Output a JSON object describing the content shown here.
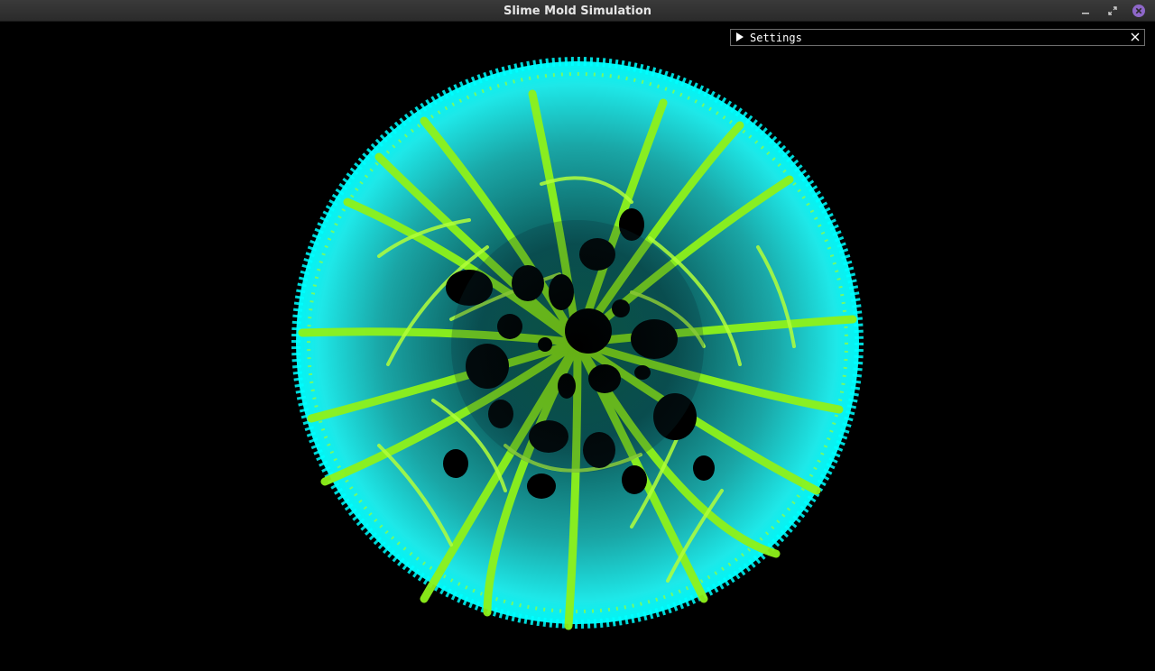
{
  "window": {
    "title": "Slime Mold Simulation",
    "controls": {
      "minimize": "minimize-icon",
      "maximize": "maximize-icon",
      "close": "close-icon",
      "close_color": "#8e67c9"
    }
  },
  "settings_panel": {
    "label": "Settings",
    "collapsed": true,
    "expand_icon": "triangle-right-icon",
    "close_icon": "close-icon"
  },
  "simulation": {
    "colors": {
      "background": "#000000",
      "trail_dense": "#7ff200",
      "trail_diffuse": "#00f0f0"
    }
  }
}
